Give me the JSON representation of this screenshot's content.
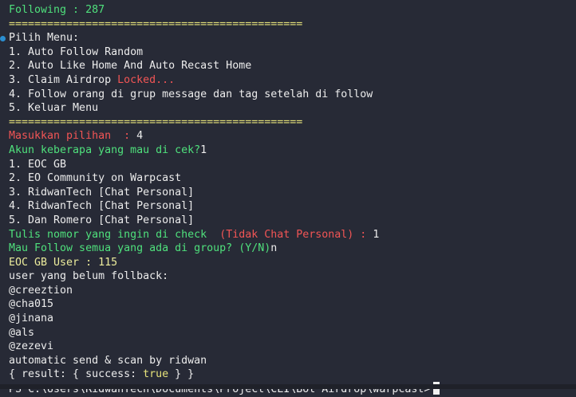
{
  "terminal": {
    "following": "Following : 287",
    "separator": "==============================================",
    "menu_title": "Pilih Menu:",
    "menu_items": [
      "1. Auto Follow Random",
      "2. Auto Like Home And Auto Recast Home",
      "3. Claim Airdrop ",
      "4. Follow orang di grup message dan tag setelah di follow",
      "5. Keluar Menu"
    ],
    "locked_label": "Locked...",
    "choice_prompt": "Masukkan pilihan  : ",
    "choice_value": "4",
    "account_prompt": "Akun keberapa yang mau di cek?",
    "account_value": "1",
    "groups": [
      "1. EOC GB",
      "2. EO Community on Warpcast",
      "3. RidwanTech [Chat Personal]",
      "4. RidwanTech [Chat Personal]",
      "5. Dan Romero [Chat Personal]"
    ],
    "number_prompt": "Tulis nomor yang ingin di check  ",
    "number_prompt_note": "(Tidak Chat Personal) : ",
    "number_value": "1",
    "follow_prompt": "Mau Follow semua yang ada di group? (Y/N)",
    "follow_value": "n",
    "group_user_count": "EOC GB User : 115",
    "not_followback_title": "user yang belum follback:",
    "users": [
      "@creeztion",
      "@cha015",
      "@jinana",
      "@als",
      "@zezevi"
    ],
    "auto_send": "automatic send & scan by ridwan",
    "result_prefix": "{ result: { success: ",
    "result_value": "true",
    "result_suffix": " } }",
    "prompt": "PS C:\\Users\\RidwanTech\\Documents\\Project\\CLI\\Bot Airdrop\\warpcast>"
  },
  "colors": {
    "background": "#272a36",
    "green": "#4fe07c",
    "yellow": "#e6e27a",
    "red": "#f25555",
    "text": "#e8e8e8"
  }
}
